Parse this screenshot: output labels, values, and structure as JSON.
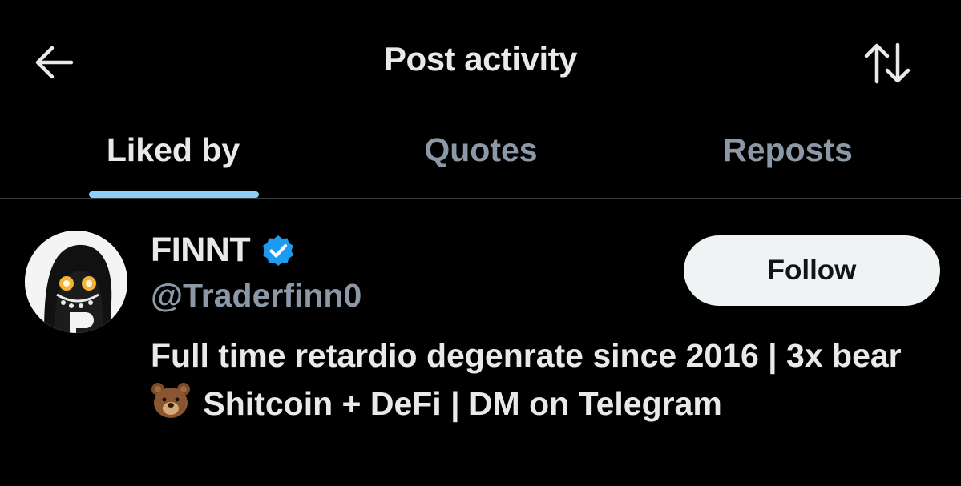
{
  "header": {
    "title": "Post activity",
    "back_icon": "back-arrow-icon",
    "sort_icon": "sort-arrows-icon"
  },
  "tabs": [
    {
      "label": "Liked by",
      "active": true
    },
    {
      "label": "Quotes",
      "active": false
    },
    {
      "label": "Reposts",
      "active": false
    }
  ],
  "user": {
    "display_name": "FINNT",
    "handle": "@Traderfinn0",
    "verified_icon": "verified-badge-icon",
    "follow_label": "Follow",
    "bio_part1": "Full time retardio degenrate since 2016 | 3x bear",
    "bio_emoji": "bear-face-icon",
    "bio_part2": "Shitcoin + DeFi | DM on Telegram"
  },
  "colors": {
    "background": "#000000",
    "primary_text": "#e7e9ea",
    "secondary_text": "#8b98a5",
    "accent": "#8ecdf8",
    "verified": "#1d9bf0",
    "follow_bg": "#eff3f4",
    "divider": "#3a3f44"
  }
}
